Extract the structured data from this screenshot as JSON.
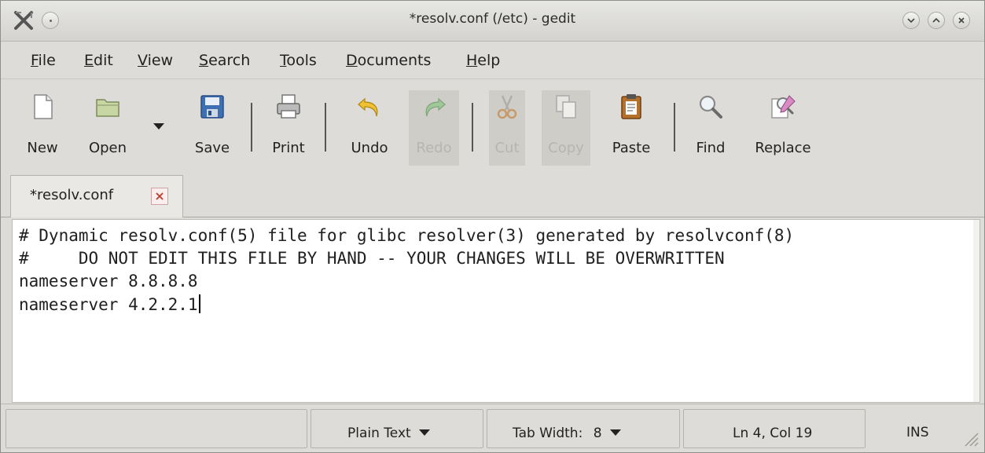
{
  "window": {
    "title": "*resolv.conf (/etc) - gedit"
  },
  "menu": {
    "items": [
      {
        "pre": "",
        "u": "F",
        "post": "ile"
      },
      {
        "pre": "",
        "u": "E",
        "post": "dit"
      },
      {
        "pre": "",
        "u": "V",
        "post": "iew"
      },
      {
        "pre": "",
        "u": "S",
        "post": "earch"
      },
      {
        "pre": "",
        "u": "T",
        "post": "ools"
      },
      {
        "pre": "",
        "u": "D",
        "post": "ocuments"
      },
      {
        "pre": "",
        "u": "H",
        "post": "elp"
      }
    ]
  },
  "toolbar": {
    "new": "New",
    "open": "Open",
    "save": "Save",
    "print": "Print",
    "undo": "Undo",
    "redo": "Redo",
    "cut": "Cut",
    "copy": "Copy",
    "paste": "Paste",
    "find": "Find",
    "replace": "Replace"
  },
  "tabs": [
    {
      "label": "*resolv.conf"
    }
  ],
  "editor": {
    "lines": [
      "# Dynamic resolv.conf(5) file for glibc resolver(3) generated by resolvconf(8)",
      "#     DO NOT EDIT THIS FILE BY HAND -- YOUR CHANGES WILL BE OVERWRITTEN",
      "nameserver 8.8.8.8",
      "nameserver 4.2.2.1"
    ]
  },
  "statusbar": {
    "language": "Plain Text",
    "tab_width_label": "Tab Width:",
    "tab_width_value": "8",
    "position": "Ln 4, Col 19",
    "mode": "INS"
  }
}
